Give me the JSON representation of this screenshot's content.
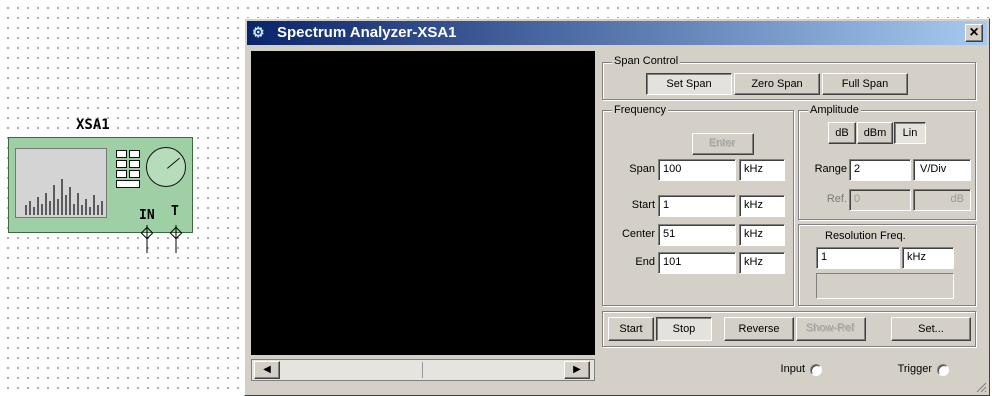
{
  "schematic": {
    "instrument_label": "XSA1",
    "pin_in": "IN",
    "pin_trigger": "T"
  },
  "window": {
    "title": "Spectrum Analyzer-XSA1",
    "close_glyph": "×",
    "scroll_left": "◀",
    "scroll_right": "▶"
  },
  "span_control": {
    "label": "Span Control",
    "buttons": [
      "Set Span",
      "Zero Span",
      "Full Span"
    ],
    "selected": "Set Span"
  },
  "frequency": {
    "label": "Frequency",
    "enter_label": "Enter",
    "span": {
      "label": "Span",
      "value": "100",
      "unit": "kHz"
    },
    "start": {
      "label": "Start",
      "value": "1",
      "unit": "kHz"
    },
    "center": {
      "label": "Center",
      "value": "51",
      "unit": "kHz"
    },
    "end": {
      "label": "End",
      "value": "101",
      "unit": "kHz"
    }
  },
  "amplitude": {
    "label": "Amplitude",
    "modes": [
      "dB",
      "dBm",
      "Lin"
    ],
    "selected": "Lin",
    "range": {
      "label": "Range",
      "value": "2",
      "unit": "V/Div"
    },
    "ref": {
      "label": "Ref.",
      "value": "0",
      "unit": "dB"
    }
  },
  "resolution": {
    "label": "Resolution Freq.",
    "value": "1",
    "unit": "kHz"
  },
  "controls": {
    "start": "Start",
    "stop": "Stop",
    "reverse": "Reverse",
    "show_ref": "Show-Ref",
    "set": "Set..."
  },
  "terminals": {
    "input": "Input",
    "trigger": "Trigger"
  }
}
